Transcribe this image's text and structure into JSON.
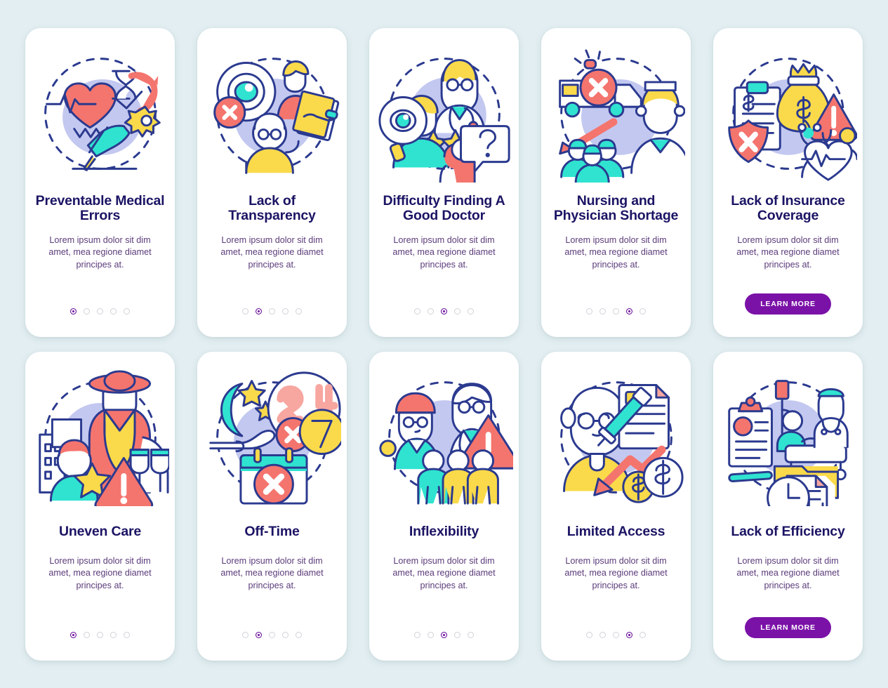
{
  "theme": {
    "background": "#e2eef1",
    "card_background": "#ffffff",
    "title_color": "#1b1464",
    "body_color": "#5b3b7a",
    "accent_color": "#6a0f9c",
    "button_color": "#7b12a8",
    "dot_inactive_color": "#cfd2d8"
  },
  "body_text": "Lorem ipsum dolor sit dim amet, mea regione diamet principes at.",
  "learn_more_label": "LEARN MORE",
  "dot_count": 5,
  "cards": [
    {
      "title": "Preventable Medical Errors",
      "illustration": "heart-hourglass-gear-hand-pen-icon",
      "body": "Lorem ipsum dolor sit dim amet, mea regione diamet principes at.",
      "footer_type": "dots",
      "active_dot": 1
    },
    {
      "title": "Lack of Transparency",
      "illustration": "eye-cross-people-document-icon",
      "body": "Lorem ipsum dolor sit dim amet, mea regione diamet principes at.",
      "footer_type": "dots",
      "active_dot": 2
    },
    {
      "title": "Difficulty Finding A Good Doctor",
      "illustration": "doctor-stars-magnifier-question-icon",
      "body": "Lorem ipsum dolor sit dim amet, mea regione diamet principes at.",
      "footer_type": "dots",
      "active_dot": 3
    },
    {
      "title": "Nursing and Physician Shortage",
      "illustration": "ambulance-cross-nurse-crowd-icon",
      "body": "Lorem ipsum dolor sit dim amet, mea regione diamet principes at.",
      "footer_type": "dots",
      "active_dot": 4
    },
    {
      "title": "Lack of Insurance Coverage",
      "illustration": "clipboard-moneybag-warning-stethoscope-icon",
      "body": "Lorem ipsum dolor sit dim amet, mea regione diamet principes at.",
      "footer_type": "button",
      "active_dot": 0
    },
    {
      "title": "Uneven Care",
      "illustration": "farmer-city-star-warning-icon",
      "body": "Lorem ipsum dolor sit dim amet, mea regione diamet principes at.",
      "footer_type": "dots",
      "active_dot": 1
    },
    {
      "title": "Off-Time",
      "illustration": "moon-stars-hand-247-calendar-cross-icon",
      "body": "Lorem ipsum dolor sit dim amet, mea regione diamet principes at.",
      "footer_type": "dots",
      "active_dot": 2
    },
    {
      "title": "Inflexibility",
      "illustration": "nurse-doctor-warning-crowd-icon",
      "body": "Lorem ipsum dolor sit dim amet, mea regione diamet principes at.",
      "footer_type": "dots",
      "active_dot": 3
    },
    {
      "title": "Limited Access",
      "illustration": "elder-syringe-document-arrow-coins-icon",
      "body": "Lorem ipsum dolor sit dim amet, mea regione diamet principes at.",
      "footer_type": "dots",
      "active_dot": 4
    },
    {
      "title": "Lack of Efficiency",
      "illustration": "clipboard-hospitalbed-folder-clock-icon",
      "body": "Lorem ipsum dolor sit dim amet, mea regione diamet principes at.",
      "footer_type": "button",
      "active_dot": 0
    }
  ]
}
